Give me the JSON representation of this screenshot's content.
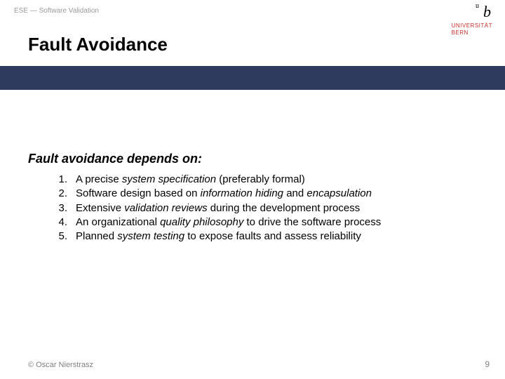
{
  "header": {
    "course_label": "ESE — Software Validation"
  },
  "logo": {
    "mark": "b",
    "sup": "u",
    "uni_line1": "UNIVERSITÄT",
    "uni_line2": "BERN"
  },
  "title": "Fault Avoidance",
  "subhead": "Fault avoidance depends on:",
  "items": [
    {
      "n": "1.",
      "html": "A precise <em>system specification</em> (preferably formal)"
    },
    {
      "n": "2.",
      "html": "Software design based on <em>information hiding</em> and <em>encapsulation</em>"
    },
    {
      "n": "3.",
      "html": "Extensive <em>validation reviews</em> during the development process"
    },
    {
      "n": "4.",
      "html": "An organizational <em>quality philosophy</em> to drive the software process"
    },
    {
      "n": "5.",
      "html": "Planned <em>system testing</em> to expose faults and assess reliability"
    }
  ],
  "footer": {
    "copyright": "© Oscar Nierstrasz",
    "page": "9"
  }
}
